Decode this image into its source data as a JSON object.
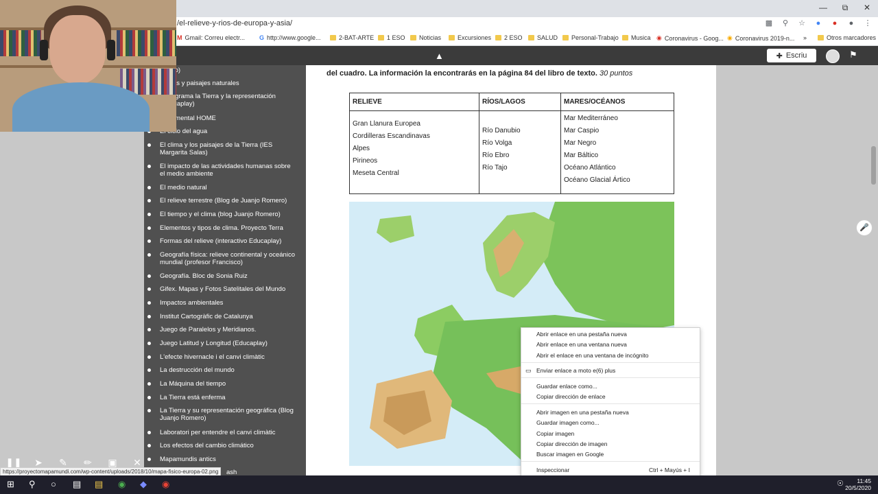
{
  "browser": {
    "url": "/el-relieve-y-rios-de-europa-y-asia/",
    "bookmarks": [
      "Gmail: Correu electr...",
      "http://www.google...",
      "2-BAT-ARTE",
      "1 ESO",
      "Noticias",
      "Excursiones",
      "2 ESO",
      "SALUD",
      "Personal-Trabajo",
      "Musica",
      "Coronavirus - Goog...",
      "Coronavirus 2019-n...",
      "»",
      "Otros marcadores"
    ]
  },
  "site_header": {
    "write_label": "Escriu"
  },
  "sidebar": {
    "items": [
      "omero)",
      "Climas y paisajes naturales",
      "Crucigrama la Tierra y la representación (Educaplay)",
      "Documental HOME",
      "El ciclo del agua",
      "El clima y los paisajes de la Tierra (IES Margarita Salas)",
      "El impacto de las actividades humanas sobre el medio ambiente",
      "El medio natural",
      "El relieve terrestre (Blog de Juanjo Romero)",
      "El tiempo y el clima (blog Juanjo Romero)",
      "Elementos y tipos de clima. Proyecto Terra",
      "Formas del relieve (interactivo Educaplay)",
      "Geografía física: relieve continental y oceánico mundial (profesor Francisco)",
      "Geografía. Bloc de Sonia Ruiz",
      "Gifex. Mapas y Fotos Satelitales del Mundo",
      "Impactos ambientales",
      "Institut Cartogràfic de Catalunya",
      "Juego de Paralelos y Meridianos.",
      "Juego Latitud y Longitud (Educaplay)",
      "L'efecte hivernacle i el canvi climàtic",
      "La destrucción del mundo",
      "La Máquina del tiempo",
      "La Tierra está enferma",
      "La Tierra y su representación geográfica (Blog Juanjo Romero)",
      "Laboratori per entendre el canvi climàtic",
      "Los efectos del cambio climático",
      "Mapamundis antics",
      "ash"
    ]
  },
  "document": {
    "intro_text": "del cuadro. La información la encontrarás en la página 84  del libro de texto.",
    "points": "30  puntos",
    "table": {
      "headers": [
        "RELIEVE",
        "RÍOS/LAGOS",
        "MARES/OCÉANOS"
      ],
      "relieve": [
        "Gran Llanura Europea",
        "Cordilleras Escandinavas",
        "Alpes",
        "Pirineos",
        "Meseta Central"
      ],
      "rios": [
        "Río Danubio",
        "Río Volga",
        "Río Ebro",
        "Río Tajo"
      ],
      "mares": [
        "Mar Mediterráneo",
        "Mar Caspio",
        "Mar Negro",
        "Mar Báltico",
        "Océano Atlántico",
        "Océano Glacial Ártico"
      ]
    }
  },
  "context_menu": {
    "items": [
      "Abrir enlace en una pestaña nueva",
      "Abrir enlace en una ventana nueva",
      "Abrir el enlace en una ventana de incógnito",
      "Enviar enlace a moto e(6) plus",
      "Guardar enlace como...",
      "Copiar dirección de enlace",
      "Abrir imagen en una pestaña nueva",
      "Guardar imagen como...",
      "Copiar imagen",
      "Copiar dirección de imagen",
      "Buscar imagen en Google",
      "Inspeccionar"
    ],
    "inspect_shortcut": "Ctrl + Mayús + I"
  },
  "status_url": "https://proyectomapamundi.com/wp-content/uploads/2018/10/mapa-fisico-europa-02.png",
  "taskbar": {
    "time": "11:45",
    "date": "20/5/2020"
  }
}
